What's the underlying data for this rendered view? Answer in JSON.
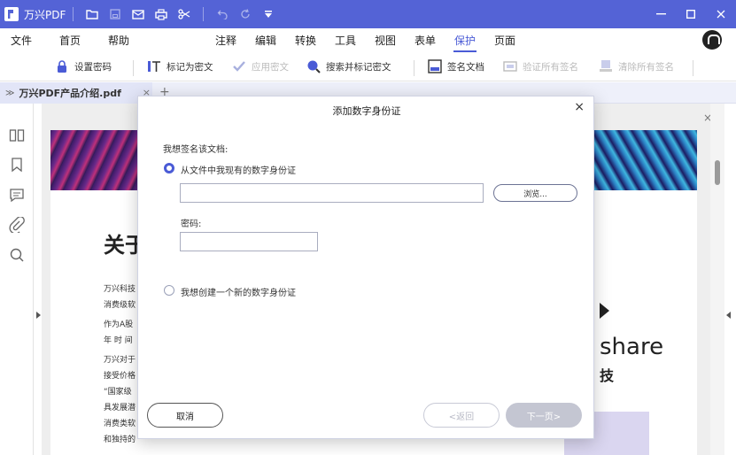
{
  "app": {
    "title": "万兴PDF",
    "accent_color": "#5463d6"
  },
  "titlebar_icons": [
    "folder-icon",
    "save-icon",
    "mail-icon",
    "print-icon",
    "scissors-icon",
    "undo-icon",
    "redo-icon",
    "quick-access-dropdown-icon"
  ],
  "menu": {
    "file": "文件",
    "home": "首页",
    "help": "帮助",
    "annotate": "注释",
    "edit": "编辑",
    "convert": "转换",
    "tools": "工具",
    "view": "视图",
    "form": "表单",
    "protect": "保护",
    "page": "页面",
    "active": "保护"
  },
  "toolbar": {
    "set_password": "设置密码",
    "mark_redaction": "标记为密文",
    "apply_redaction": "应用密文",
    "search_mark_redaction": "搜索并标记密文",
    "sign_document": "签名文档",
    "verify_all_signatures": "验证所有签名",
    "clear_all_signatures": "清除所有签名"
  },
  "tab": {
    "filename": "万兴PDF产品介绍.pdf",
    "chevron": "≫",
    "close": "×",
    "add": "+"
  },
  "document": {
    "heading": "关于",
    "lines": [
      "万兴科技",
      "消费级软",
      "作为A股",
      "年 时 间",
      "万兴对于",
      "接受价格",
      "“国家级",
      "具发展潜",
      "消费类软",
      "和独持的"
    ],
    "logo_text": "share",
    "logo_sub": "技",
    "close": "×"
  },
  "dialog": {
    "title": "添加数字身份证",
    "close": "×",
    "prompt": "我想签名该文档:",
    "option_existing": "从文件中我现有的数字身份证",
    "file_path_value": "",
    "browse": "浏览...",
    "password_label": "密码:",
    "password_value": "",
    "option_new": "我想创建一个新的数字身份证",
    "selected_option": "existing",
    "cancel": "取消",
    "back": "<返回",
    "next": "下一页>"
  }
}
